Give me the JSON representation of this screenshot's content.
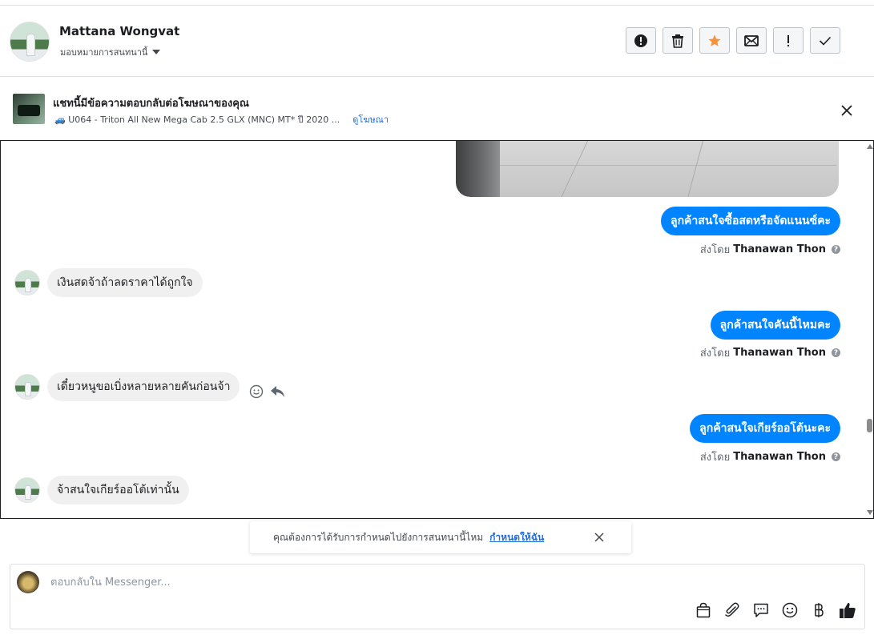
{
  "header": {
    "contact_name": "Mattana Wongvat",
    "assign_label": "มอบหมายการสนทนานี้",
    "actions": [
      {
        "icon": "alert-circle-icon"
      },
      {
        "icon": "trash-icon"
      },
      {
        "icon": "star-icon"
      },
      {
        "icon": "envelope-icon"
      },
      {
        "icon": "exclamation-icon"
      },
      {
        "icon": "checkmark-icon"
      }
    ]
  },
  "ad_banner": {
    "title": "แชทนี้มีข้อความตอบกลับต่อโฆษณาของคุณ",
    "subtitle": "🚙 U064 - Triton All New Mega Cab 2.5 GLX (MNC) MT* ปี 2020 ...",
    "link": "ดูโฆษณา"
  },
  "messages": {
    "sent_by_prefix": "ส่งโดย",
    "agent": "Thanawan Thon",
    "out_1": "ลูกค้าสนใจซื้อสดหรือจัดแนนซ์คะ",
    "in_1": "เงินสดจ้าถ้าลดราคาได้ถูกใจ",
    "out_2": "ลูกค้าสนใจคันนี้ไหมคะ",
    "in_2": "เดี๋ยวหนูขอเบิ่งหลายหลายคันก่อนจ้า",
    "out_3": "ลูกค้าสนใจเกียร์ออโต้นะคะ",
    "in_3": "จ้าสนใจเกียร์ออโต้เท่านั้น"
  },
  "notice": {
    "text": "คุณต้องการได้รับการกำหนดไปยังการสนทนานี้ไหม",
    "link": "กำหนดให้ฉัน"
  },
  "composer": {
    "placeholder": "ตอบกลับใน Messenger...",
    "value": "",
    "tools": [
      "shopping-bag-icon",
      "paperclip-icon",
      "saved-reply-icon",
      "emoji-icon",
      "baht-icon",
      "thumbs-up-icon"
    ]
  },
  "colors": {
    "accent": "#0084ff",
    "link": "#216fdb",
    "incoming_bubble": "#f1f0f0",
    "star": "#f7923b"
  }
}
